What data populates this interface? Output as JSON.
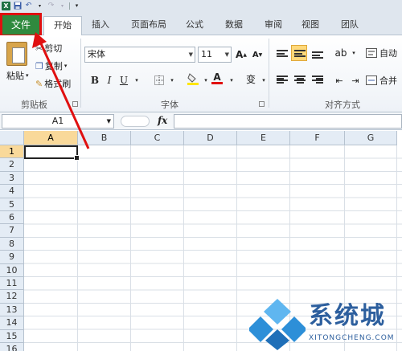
{
  "quick_access": {
    "excel_icon": "X"
  },
  "tabs": [
    {
      "label": "文件"
    },
    {
      "label": "开始"
    },
    {
      "label": "插入"
    },
    {
      "label": "页面布局"
    },
    {
      "label": "公式"
    },
    {
      "label": "数据"
    },
    {
      "label": "审阅"
    },
    {
      "label": "视图"
    },
    {
      "label": "团队"
    }
  ],
  "clipboard": {
    "paste": "粘贴",
    "cut": "剪切",
    "copy": "复制",
    "format_painter": "格式刷",
    "group": "剪贴板"
  },
  "font": {
    "name": "宋体",
    "size": "11",
    "group": "字体",
    "bold": "B",
    "italic": "I",
    "underline": "U",
    "grow": "A",
    "shrink": "A",
    "color_a": "A",
    "phonetic": "变"
  },
  "alignment": {
    "group": "对齐方式",
    "wrap": "自动",
    "merge": "合并"
  },
  "formula_bar": {
    "name_box": "A1",
    "fx": "fx"
  },
  "columns": [
    "A",
    "B",
    "C",
    "D",
    "E",
    "F",
    "G"
  ],
  "rows": [
    "1",
    "2",
    "3",
    "4",
    "5",
    "6",
    "7",
    "8",
    "9",
    "10",
    "11",
    "12",
    "13",
    "14",
    "15",
    "16"
  ],
  "watermark": {
    "title": "系统城",
    "subtitle": "XITONGCHENG.COM"
  },
  "colors": {
    "file_tab": "#2f8a3e",
    "highlight": "#e01010",
    "selection": "#f9d99a",
    "watermark": "#2d5f9e"
  }
}
